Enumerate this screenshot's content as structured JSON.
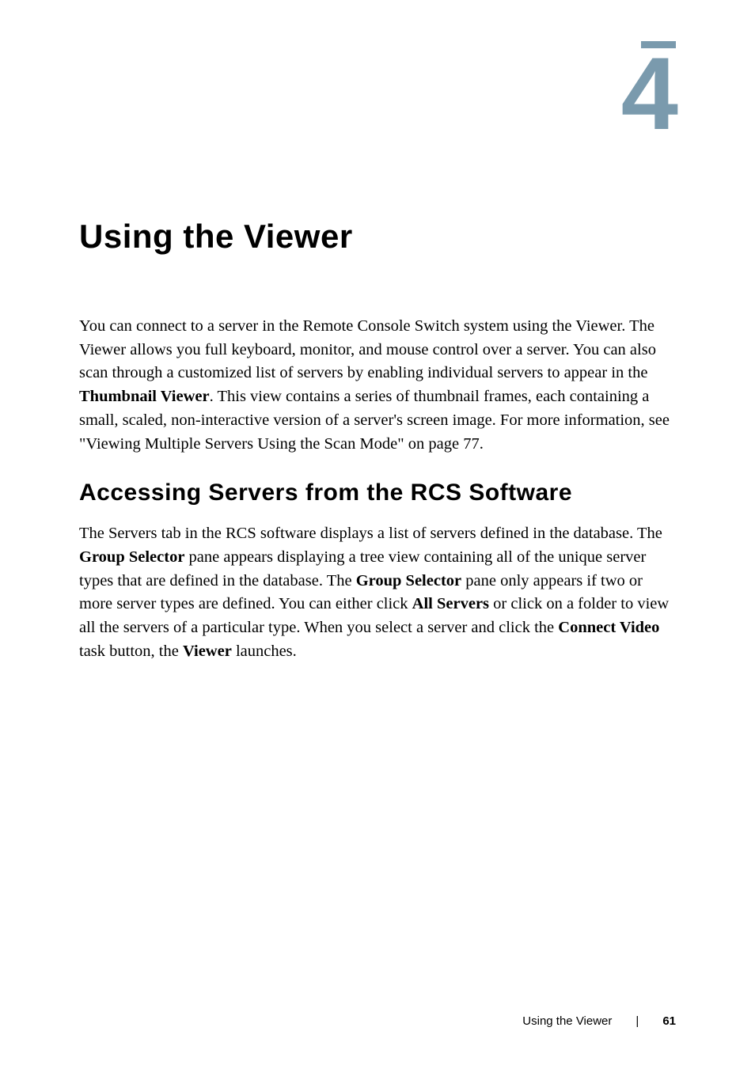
{
  "chapter": {
    "number": "4",
    "title": "Using the Viewer"
  },
  "paragraphs": {
    "intro_part1": "You can connect to a server in the Remote Console Switch system using the Viewer. The Viewer allows you full keyboard, monitor, and mouse control over a server. You can also scan through a customized list of servers by enabling individual servers to appear in the ",
    "intro_bold1": "Thumbnail Viewer",
    "intro_part2": ". This view contains a series of thumbnail frames, each containing a small, scaled, non-interactive version of a server's screen image. For more information, see \"Viewing Multiple Servers Using the Scan Mode\" on page 77."
  },
  "section": {
    "heading": "Accessing Servers from the RCS Software",
    "body_part1": "The Servers tab in the RCS software displays a list of servers defined in the database. The ",
    "body_bold1": "Group Selector",
    "body_part2": " pane appears displaying a tree view containing all of the unique server types that are defined in the database. The ",
    "body_bold2": "Group Selector",
    "body_part3": " pane only appears if two or more server types are defined. You can either click ",
    "body_bold3": "All Servers",
    "body_part4": " or click on a folder to view all the servers of a particular type. When you select a server and click the ",
    "body_bold4": "Connect Video",
    "body_part5": " task button, the ",
    "body_bold5": "Viewer",
    "body_part6": " launches."
  },
  "footer": {
    "title": "Using the Viewer",
    "separator": "|",
    "page": "61"
  }
}
